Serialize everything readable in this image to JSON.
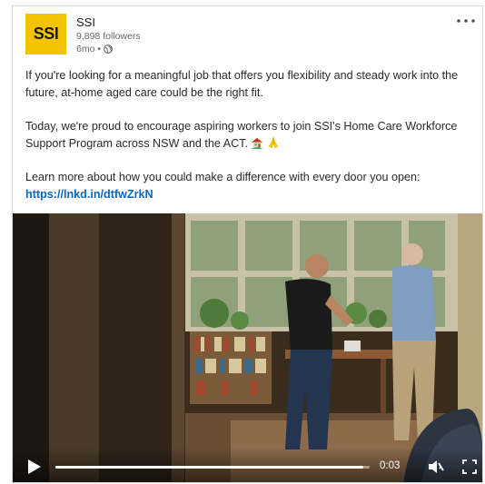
{
  "post": {
    "author": {
      "logo_text": "SSI",
      "name": "SSI",
      "followers": "9,898 followers",
      "time": "6mo •"
    },
    "more_icon": "more-horizontal-icon",
    "paragraphs": [
      "If you're looking for a meaningful job that offers you flexibility and steady work into the future, at-home aged care could be the right fit.",
      "Today, we're proud to encourage aspiring workers to join SSI's Home Care Workforce Support Program across NSW and the ACT."
    ],
    "learn_more": "Learn more about how you could make a difference with every door you open:",
    "link": "https://lnkd.in/dtfwZrkN"
  },
  "video": {
    "timestamp": "0:03",
    "progress": 0.98,
    "muted": true,
    "icons": {
      "play": "play-icon",
      "mute": "muted-speaker-icon",
      "fullscreen": "fullscreen-icon"
    }
  },
  "colors": {
    "logo_bg": "#f5c400",
    "link": "#0a66c2"
  }
}
